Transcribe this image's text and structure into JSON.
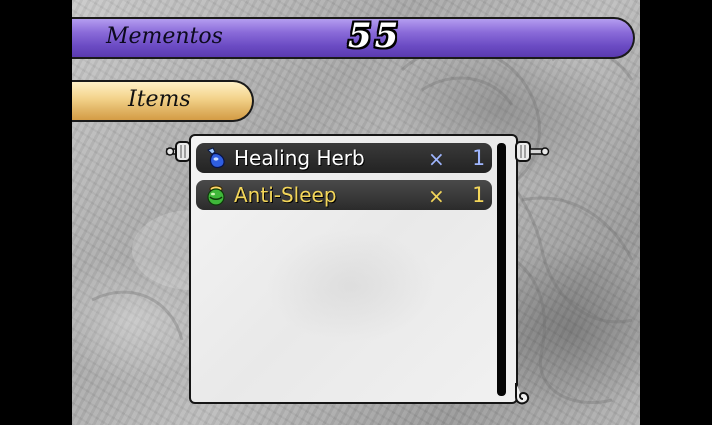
{
  "header": {
    "label": "Mementos",
    "count": "55"
  },
  "category_tab": {
    "label": "Items"
  },
  "items": [
    {
      "name": "Healing Herb",
      "multiplier": "×",
      "quantity": "1",
      "icon": "blue-potion-icon",
      "text_color": "#ffffff",
      "accent_color": "#9fb6ff"
    },
    {
      "name": "Anti-Sleep",
      "multiplier": "×",
      "quantity": "1",
      "icon": "green-potion-icon",
      "text_color": "#f3d65a",
      "accent_color": "#f3d65a"
    }
  ],
  "colors": {
    "mementos_bar": "#7a5ad0",
    "items_tab": "#e8c275",
    "selected_row_text": "#f3d65a"
  }
}
